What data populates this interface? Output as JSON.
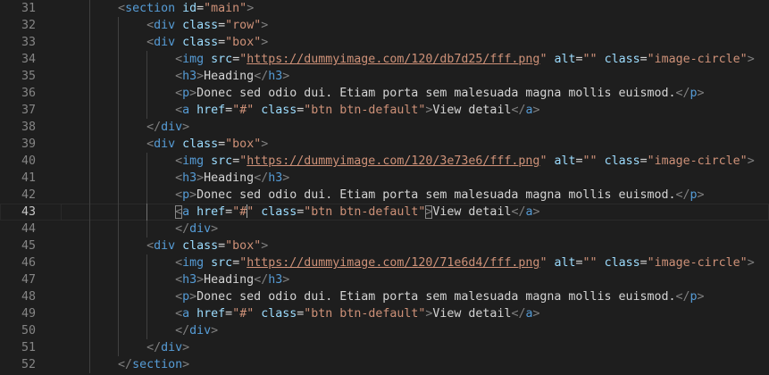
{
  "editor": {
    "lines": [
      {
        "num": "31",
        "indent": 2,
        "tokens": [
          {
            "t": "<",
            "c": "punct"
          },
          {
            "t": "section",
            "c": "tag"
          },
          {
            "t": " "
          },
          {
            "t": "id",
            "c": "attr"
          },
          {
            "t": "=",
            "c": "txt"
          },
          {
            "t": "\"main\"",
            "c": "str"
          },
          {
            "t": ">",
            "c": "punct"
          }
        ]
      },
      {
        "num": "32",
        "indent": 3,
        "tokens": [
          {
            "t": "<",
            "c": "punct"
          },
          {
            "t": "div",
            "c": "tag"
          },
          {
            "t": " "
          },
          {
            "t": "class",
            "c": "attr"
          },
          {
            "t": "=",
            "c": "txt"
          },
          {
            "t": "\"row\"",
            "c": "str"
          },
          {
            "t": ">",
            "c": "punct"
          }
        ]
      },
      {
        "num": "33",
        "indent": 3,
        "tokens": [
          {
            "t": "<",
            "c": "punct"
          },
          {
            "t": "div",
            "c": "tag"
          },
          {
            "t": " "
          },
          {
            "t": "class",
            "c": "attr"
          },
          {
            "t": "=",
            "c": "txt"
          },
          {
            "t": "\"box\"",
            "c": "str"
          },
          {
            "t": ">",
            "c": "punct"
          }
        ]
      },
      {
        "num": "34",
        "indent": 4,
        "tokens": [
          {
            "t": "<",
            "c": "punct"
          },
          {
            "t": "img",
            "c": "tag"
          },
          {
            "t": " "
          },
          {
            "t": "src",
            "c": "attr"
          },
          {
            "t": "=",
            "c": "txt"
          },
          {
            "t": "\"",
            "c": "str"
          },
          {
            "t": "https://dummyimage.com/120/db7d25/fff.png",
            "c": "url"
          },
          {
            "t": "\"",
            "c": "str"
          },
          {
            "t": " "
          },
          {
            "t": "alt",
            "c": "attr"
          },
          {
            "t": "=",
            "c": "txt"
          },
          {
            "t": "\"\"",
            "c": "str"
          },
          {
            "t": " "
          },
          {
            "t": "class",
            "c": "attr"
          },
          {
            "t": "=",
            "c": "txt"
          },
          {
            "t": "\"image-circle\"",
            "c": "str"
          },
          {
            "t": ">",
            "c": "punct"
          }
        ]
      },
      {
        "num": "35",
        "indent": 4,
        "tokens": [
          {
            "t": "<",
            "c": "punct"
          },
          {
            "t": "h3",
            "c": "tag"
          },
          {
            "t": ">",
            "c": "punct"
          },
          {
            "t": "Heading",
            "c": "txt"
          },
          {
            "t": "</",
            "c": "punct"
          },
          {
            "t": "h3",
            "c": "tag"
          },
          {
            "t": ">",
            "c": "punct"
          }
        ]
      },
      {
        "num": "36",
        "indent": 4,
        "tokens": [
          {
            "t": "<",
            "c": "punct"
          },
          {
            "t": "p",
            "c": "tag"
          },
          {
            "t": ">",
            "c": "punct"
          },
          {
            "t": "Donec sed odio dui. Etiam porta sem malesuada magna mollis euismod.",
            "c": "txt"
          },
          {
            "t": "</",
            "c": "punct"
          },
          {
            "t": "p",
            "c": "tag"
          },
          {
            "t": ">",
            "c": "punct"
          }
        ]
      },
      {
        "num": "37",
        "indent": 4,
        "tokens": [
          {
            "t": "<",
            "c": "punct"
          },
          {
            "t": "a",
            "c": "tag"
          },
          {
            "t": " "
          },
          {
            "t": "href",
            "c": "attr"
          },
          {
            "t": "=",
            "c": "txt"
          },
          {
            "t": "\"#\"",
            "c": "str"
          },
          {
            "t": " "
          },
          {
            "t": "class",
            "c": "attr"
          },
          {
            "t": "=",
            "c": "txt"
          },
          {
            "t": "\"btn btn-default\"",
            "c": "str"
          },
          {
            "t": ">",
            "c": "punct"
          },
          {
            "t": "View detail",
            "c": "txt"
          },
          {
            "t": "</",
            "c": "punct"
          },
          {
            "t": "a",
            "c": "tag"
          },
          {
            "t": ">",
            "c": "punct"
          }
        ]
      },
      {
        "num": "38",
        "indent": 3,
        "tokens": [
          {
            "t": "</",
            "c": "punct"
          },
          {
            "t": "div",
            "c": "tag"
          },
          {
            "t": ">",
            "c": "punct"
          }
        ]
      },
      {
        "num": "39",
        "indent": 3,
        "tokens": [
          {
            "t": "<",
            "c": "punct"
          },
          {
            "t": "div",
            "c": "tag"
          },
          {
            "t": " "
          },
          {
            "t": "class",
            "c": "attr"
          },
          {
            "t": "=",
            "c": "txt"
          },
          {
            "t": "\"box\"",
            "c": "str"
          },
          {
            "t": ">",
            "c": "punct"
          }
        ]
      },
      {
        "num": "40",
        "indent": 4,
        "tokens": [
          {
            "t": "<",
            "c": "punct"
          },
          {
            "t": "img",
            "c": "tag"
          },
          {
            "t": " "
          },
          {
            "t": "src",
            "c": "attr"
          },
          {
            "t": "=",
            "c": "txt"
          },
          {
            "t": "\"",
            "c": "str"
          },
          {
            "t": "https://dummyimage.com/120/3e73e6/fff.png",
            "c": "url"
          },
          {
            "t": "\"",
            "c": "str"
          },
          {
            "t": " "
          },
          {
            "t": "alt",
            "c": "attr"
          },
          {
            "t": "=",
            "c": "txt"
          },
          {
            "t": "\"\"",
            "c": "str"
          },
          {
            "t": " "
          },
          {
            "t": "class",
            "c": "attr"
          },
          {
            "t": "=",
            "c": "txt"
          },
          {
            "t": "\"image-circle\"",
            "c": "str"
          },
          {
            "t": ">",
            "c": "punct"
          }
        ]
      },
      {
        "num": "41",
        "indent": 4,
        "tokens": [
          {
            "t": "<",
            "c": "punct"
          },
          {
            "t": "h3",
            "c": "tag"
          },
          {
            "t": ">",
            "c": "punct"
          },
          {
            "t": "Heading",
            "c": "txt"
          },
          {
            "t": "</",
            "c": "punct"
          },
          {
            "t": "h3",
            "c": "tag"
          },
          {
            "t": ">",
            "c": "punct"
          }
        ]
      },
      {
        "num": "42",
        "indent": 4,
        "tokens": [
          {
            "t": "<",
            "c": "punct"
          },
          {
            "t": "p",
            "c": "tag"
          },
          {
            "t": ">",
            "c": "punct"
          },
          {
            "t": "Donec sed odio dui. Etiam porta sem malesuada magna mollis euismod.",
            "c": "txt"
          },
          {
            "t": "</",
            "c": "punct"
          },
          {
            "t": "p",
            "c": "tag"
          },
          {
            "t": ">",
            "c": "punct"
          }
        ]
      },
      {
        "num": "43",
        "indent": 4,
        "active": true,
        "tokens": [
          {
            "t": "<",
            "c": "punct",
            "match": true
          },
          {
            "t": "a",
            "c": "tag"
          },
          {
            "t": " "
          },
          {
            "t": "href",
            "c": "attr"
          },
          {
            "t": "=",
            "c": "txt"
          },
          {
            "t": "\"#",
            "c": "str"
          },
          {
            "cursor": true
          },
          {
            "t": "\"",
            "c": "str"
          },
          {
            "t": " "
          },
          {
            "t": "class",
            "c": "attr"
          },
          {
            "t": "=",
            "c": "txt"
          },
          {
            "t": "\"btn btn-default\"",
            "c": "str"
          },
          {
            "t": ">",
            "c": "punct",
            "match": true
          },
          {
            "t": "View detail",
            "c": "txt"
          },
          {
            "t": "</",
            "c": "punct"
          },
          {
            "t": "a",
            "c": "tag"
          },
          {
            "t": ">",
            "c": "punct"
          }
        ]
      },
      {
        "num": "44",
        "indent": 4,
        "tokens": [
          {
            "t": "</",
            "c": "punct"
          },
          {
            "t": "div",
            "c": "tag"
          },
          {
            "t": ">",
            "c": "punct"
          }
        ]
      },
      {
        "num": "45",
        "indent": 3,
        "tokens": [
          {
            "t": "<",
            "c": "punct"
          },
          {
            "t": "div",
            "c": "tag"
          },
          {
            "t": " "
          },
          {
            "t": "class",
            "c": "attr"
          },
          {
            "t": "=",
            "c": "txt"
          },
          {
            "t": "\"box\"",
            "c": "str"
          },
          {
            "t": ">",
            "c": "punct"
          }
        ]
      },
      {
        "num": "46",
        "indent": 4,
        "tokens": [
          {
            "t": "<",
            "c": "punct"
          },
          {
            "t": "img",
            "c": "tag"
          },
          {
            "t": " "
          },
          {
            "t": "src",
            "c": "attr"
          },
          {
            "t": "=",
            "c": "txt"
          },
          {
            "t": "\"",
            "c": "str"
          },
          {
            "t": "https://dummyimage.com/120/71e6d4/fff.png",
            "c": "url"
          },
          {
            "t": "\"",
            "c": "str"
          },
          {
            "t": " "
          },
          {
            "t": "alt",
            "c": "attr"
          },
          {
            "t": "=",
            "c": "txt"
          },
          {
            "t": "\"\"",
            "c": "str"
          },
          {
            "t": " "
          },
          {
            "t": "class",
            "c": "attr"
          },
          {
            "t": "=",
            "c": "txt"
          },
          {
            "t": "\"image-circle\"",
            "c": "str"
          },
          {
            "t": ">",
            "c": "punct"
          }
        ]
      },
      {
        "num": "47",
        "indent": 4,
        "tokens": [
          {
            "t": "<",
            "c": "punct"
          },
          {
            "t": "h3",
            "c": "tag"
          },
          {
            "t": ">",
            "c": "punct"
          },
          {
            "t": "Heading",
            "c": "txt"
          },
          {
            "t": "</",
            "c": "punct"
          },
          {
            "t": "h3",
            "c": "tag"
          },
          {
            "t": ">",
            "c": "punct"
          }
        ]
      },
      {
        "num": "48",
        "indent": 4,
        "tokens": [
          {
            "t": "<",
            "c": "punct"
          },
          {
            "t": "p",
            "c": "tag"
          },
          {
            "t": ">",
            "c": "punct"
          },
          {
            "t": "Donec sed odio dui. Etiam porta sem malesuada magna mollis euismod.",
            "c": "txt"
          },
          {
            "t": "</",
            "c": "punct"
          },
          {
            "t": "p",
            "c": "tag"
          },
          {
            "t": ">",
            "c": "punct"
          }
        ]
      },
      {
        "num": "49",
        "indent": 4,
        "tokens": [
          {
            "t": "<",
            "c": "punct"
          },
          {
            "t": "a",
            "c": "tag"
          },
          {
            "t": " "
          },
          {
            "t": "href",
            "c": "attr"
          },
          {
            "t": "=",
            "c": "txt"
          },
          {
            "t": "\"#\"",
            "c": "str"
          },
          {
            "t": " "
          },
          {
            "t": "class",
            "c": "attr"
          },
          {
            "t": "=",
            "c": "txt"
          },
          {
            "t": "\"btn btn-default\"",
            "c": "str"
          },
          {
            "t": ">",
            "c": "punct"
          },
          {
            "t": "View detail",
            "c": "txt"
          },
          {
            "t": "</",
            "c": "punct"
          },
          {
            "t": "a",
            "c": "tag"
          },
          {
            "t": ">",
            "c": "punct"
          }
        ]
      },
      {
        "num": "50",
        "indent": 4,
        "tokens": [
          {
            "t": "</",
            "c": "punct"
          },
          {
            "t": "div",
            "c": "tag"
          },
          {
            "t": ">",
            "c": "punct"
          }
        ]
      },
      {
        "num": "51",
        "indent": 3,
        "tokens": [
          {
            "t": "</",
            "c": "punct"
          },
          {
            "t": "div",
            "c": "tag"
          },
          {
            "t": ">",
            "c": "punct"
          }
        ]
      },
      {
        "num": "52",
        "indent": 2,
        "tokens": [
          {
            "t": "</",
            "c": "punct"
          },
          {
            "t": "section",
            "c": "tag"
          },
          {
            "t": ">",
            "c": "punct"
          }
        ]
      }
    ]
  },
  "colors": {
    "background": "#1e1e1e",
    "line_number": "#858585",
    "tag": "#569cd6",
    "attribute": "#9cdcfe",
    "string": "#ce9178",
    "text": "#d4d4d4",
    "punctuation": "#808080"
  }
}
